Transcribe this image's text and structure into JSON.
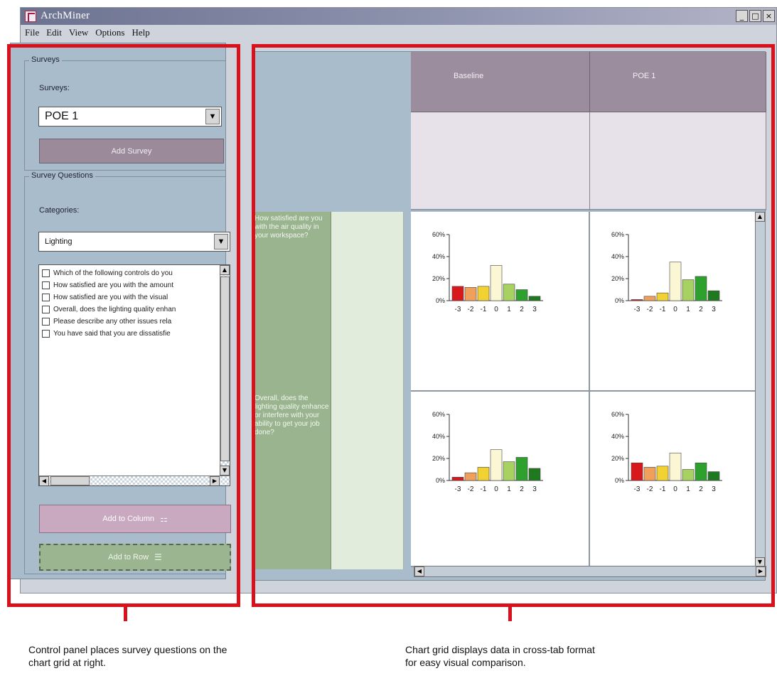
{
  "window": {
    "title": "ArchMiner",
    "buttons": [
      "_",
      "□",
      "×"
    ]
  },
  "menu": [
    "File",
    "Edit",
    "View",
    "Options",
    "Help"
  ],
  "surveys_group": {
    "title": "Surveys",
    "label": "Surveys:",
    "selected": "POE 1",
    "add_button": "Add Survey"
  },
  "questions_group": {
    "title": "Survey Questions",
    "categories_label": "Categories:",
    "category_selected": "Lighting",
    "questions": [
      "Which of the following controls do you",
      "How satisfied are you with the amount",
      "How satisfied are you with the visual",
      "Overall, does the lighting quality enhan",
      "Please describe any other issues rela",
      "You have said that you are dissatisfie"
    ],
    "add_column_button": "Add to Column",
    "add_row_button": "Add to Row"
  },
  "grid": {
    "columns": [
      "Baseline",
      "POE 1"
    ],
    "rows": [
      "How satisfied are you with the air quality in your workspace?",
      "Overall, does the lighting quality enhance or interfere with your ability to get your job done?"
    ]
  },
  "chart_data": [
    {
      "type": "bar",
      "row": 1,
      "column": "Baseline",
      "categories": [
        "-3",
        "-2",
        "-1",
        "0",
        "1",
        "2",
        "3"
      ],
      "values": [
        13,
        12,
        13,
        32,
        15,
        10,
        4
      ],
      "yticks": [
        "0%",
        "20%",
        "40%",
        "60%"
      ],
      "ylim": [
        0,
        60
      ]
    },
    {
      "type": "bar",
      "row": 1,
      "column": "POE 1",
      "categories": [
        "-3",
        "-2",
        "-1",
        "0",
        "1",
        "2",
        "3"
      ],
      "values": [
        1,
        4,
        7,
        35,
        19,
        22,
        9
      ],
      "yticks": [
        "0%",
        "20%",
        "40%",
        "60%"
      ],
      "ylim": [
        0,
        60
      ]
    },
    {
      "type": "bar",
      "row": 2,
      "column": "Baseline",
      "categories": [
        "-3",
        "-2",
        "-1",
        "0",
        "1",
        "2",
        "3"
      ],
      "values": [
        3,
        7,
        12,
        28,
        17,
        21,
        11
      ],
      "yticks": [
        "0%",
        "20%",
        "40%",
        "60%"
      ],
      "ylim": [
        0,
        60
      ]
    },
    {
      "type": "bar",
      "row": 2,
      "column": "POE 1",
      "categories": [
        "-3",
        "-2",
        "-1",
        "0",
        "1",
        "2",
        "3"
      ],
      "values": [
        16,
        12,
        13,
        25,
        10,
        16,
        8
      ],
      "yticks": [
        "0%",
        "20%",
        "40%",
        "60%"
      ],
      "ylim": [
        0,
        60
      ]
    }
  ],
  "bar_colors": [
    "#d7191c",
    "#f0a05a",
    "#f2d232",
    "#fbf7d4",
    "#a7d161",
    "#2ea02e",
    "#1f7a1f"
  ],
  "captions": {
    "left": "Control panel places survey questions on the chart grid at right.",
    "right": "Chart grid displays data in cross-tab format for easy visual comparison."
  }
}
